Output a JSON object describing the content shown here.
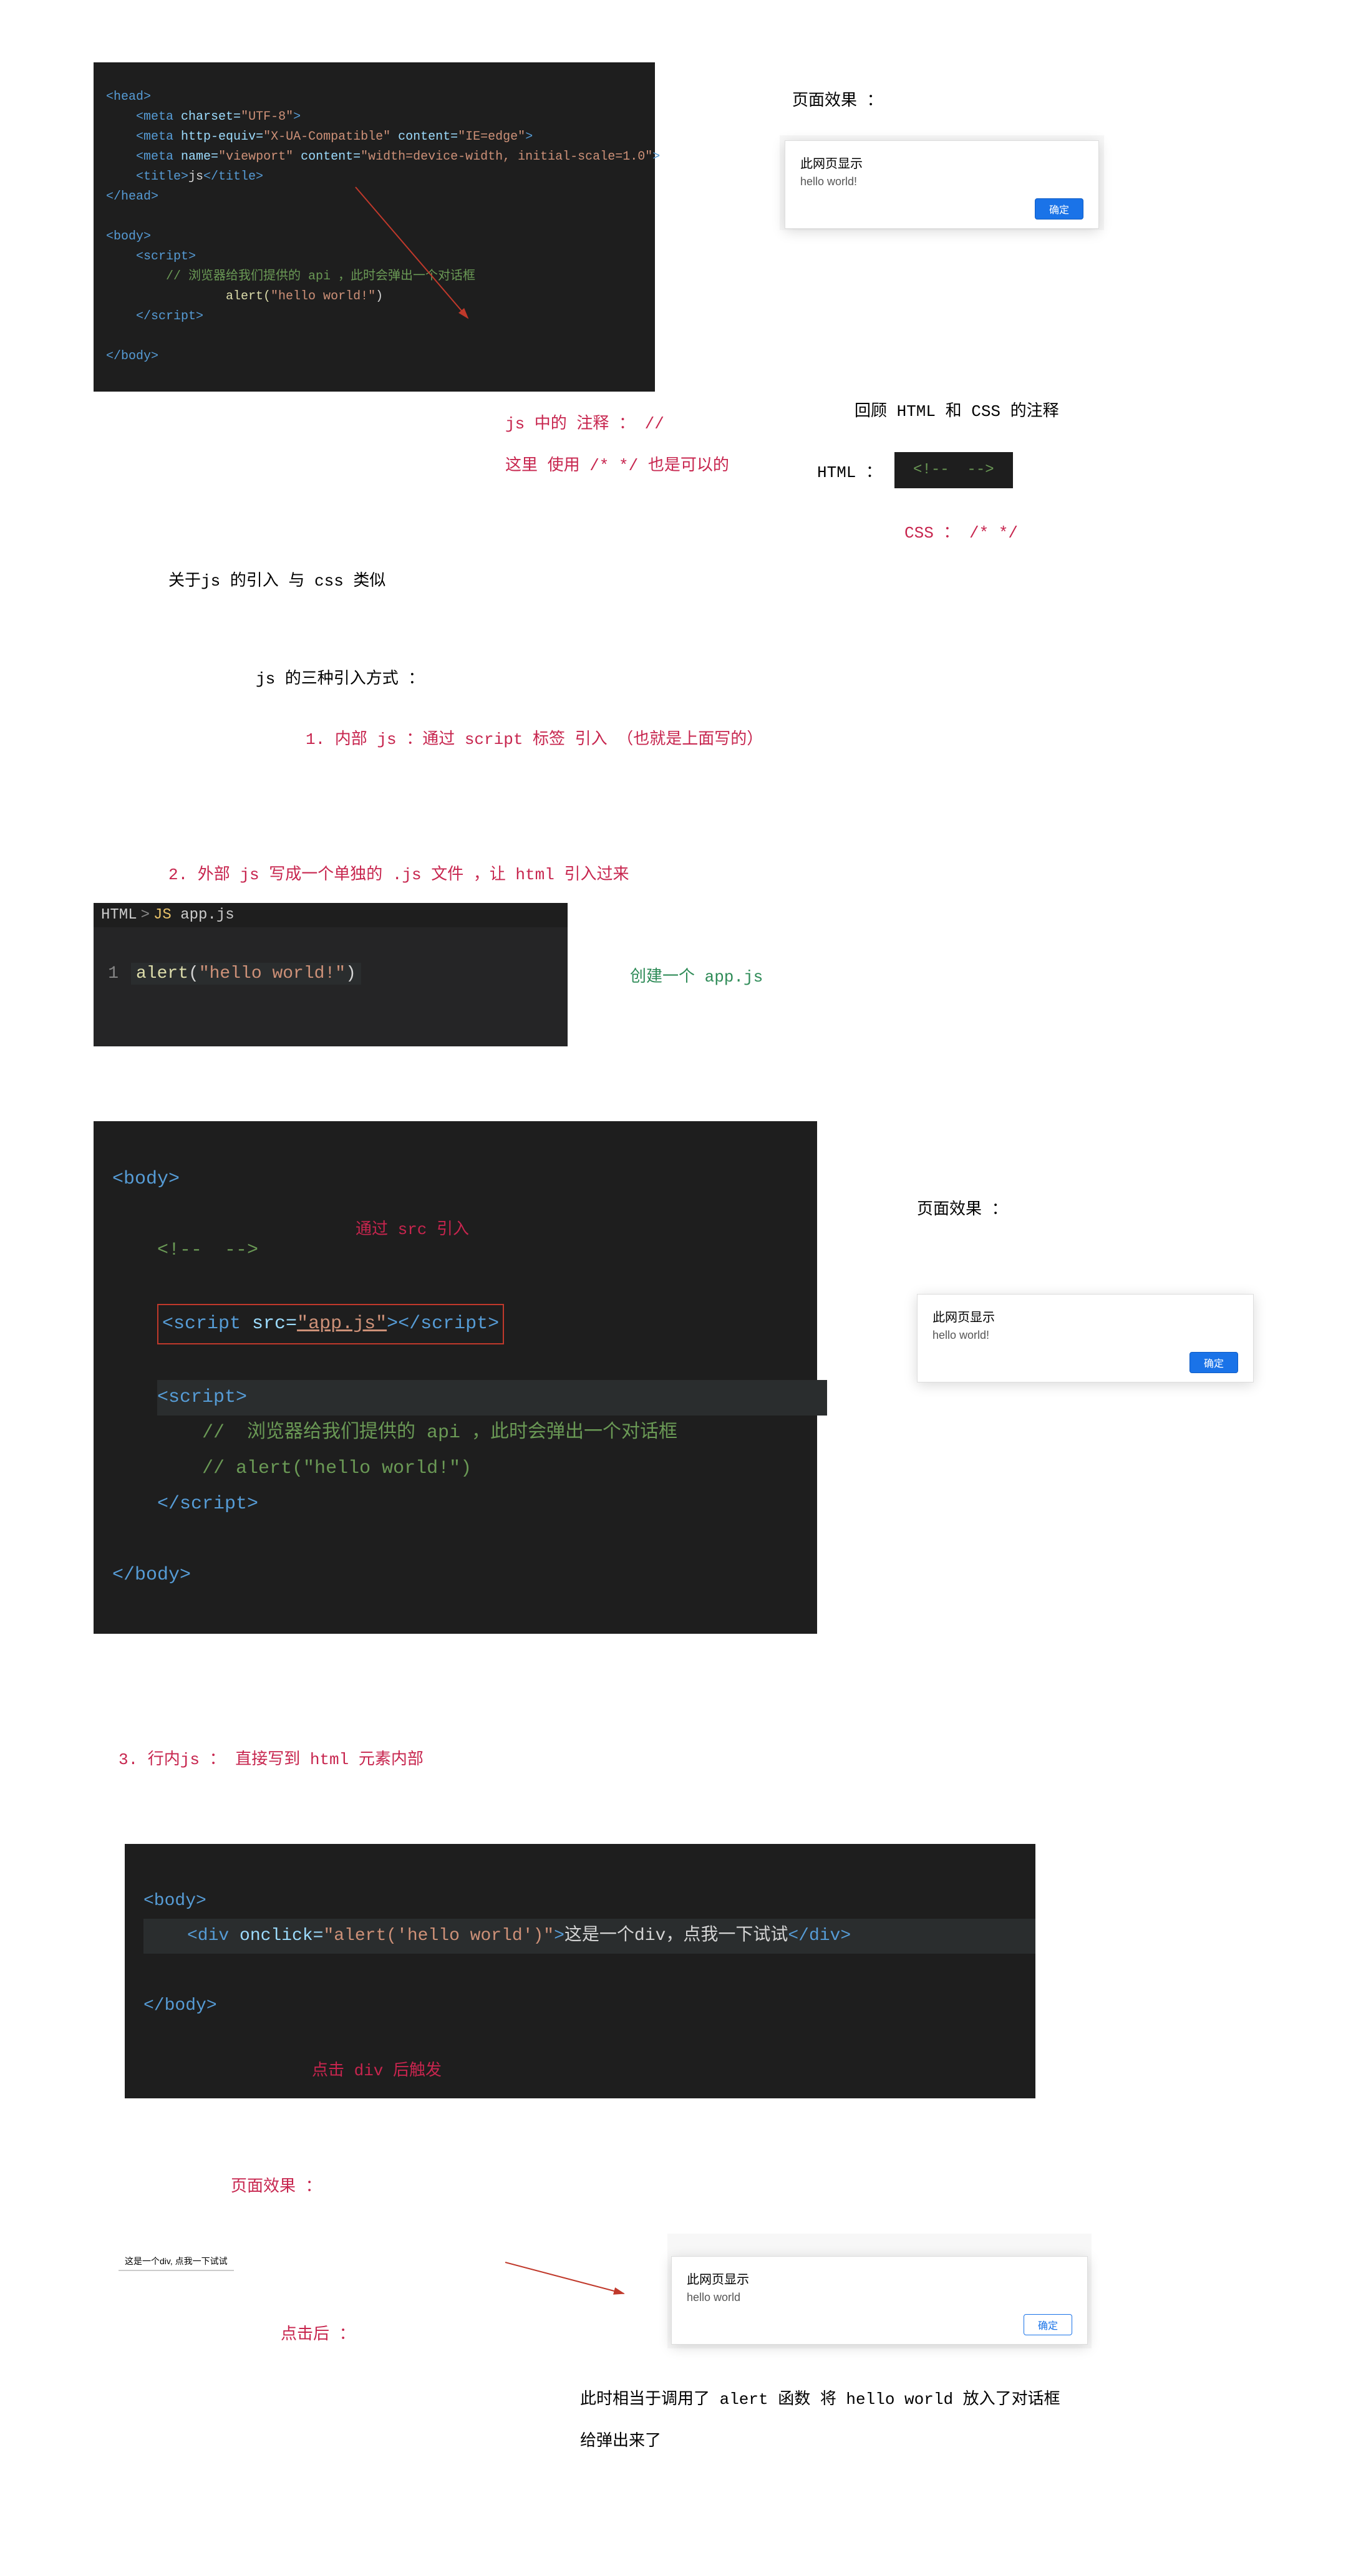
{
  "code1": {
    "l1": "<head>",
    "l2": "    <meta charset=\"UTF-8\">",
    "l3": "    <meta http-equiv=\"X-UA-Compatible\" content=\"IE=edge\">",
    "l4": "    <meta name=\"viewport\" content=\"width=device-width, initial-scale=1.0\">",
    "l5": "    <title>js</title>",
    "l6": "</head>",
    "l8": "<body>",
    "l9": "    <script>",
    "l10a": "        // 浏览器给我们提供的 api ，此时会弹出一个对话框",
    "l11a": "        alert(",
    "l11b": "\"hello world!\"",
    "l11c": ")",
    "l12": "    </script>",
    "l14": "</body>"
  },
  "labels": {
    "pageEffect": "页面效果 ：",
    "jsComment1": "js 中的 注释 ： //",
    "jsComment2": "这里 使用 /* */ 也是可以的",
    "jsImport": "关于js 的引入  与 css 类似",
    "reviewComment": "回顾 HTML 和 CSS 的注释",
    "htmlLabel": "HTML ：",
    "htmlCmt": "<!--  -->",
    "cssLabel": "CSS ： /* */",
    "threeWays": "js 的三种引入方式 ：",
    "way1": "1. 内部 js ：通过 script 标签 引入 （也就是上面写的）",
    "way2": "2. 外部 js 写成一个单独的 .js 文件 ，让 html 引入过来",
    "createApp": "创建一个 app.js",
    "viaSrc": "通过 src 引入",
    "way3": "3. 行内js ： 直接写到 html 元素内部",
    "clickDiv": "点击 div 后触发",
    "afterClick": "点击后 ：",
    "explain1": "此时相当于调用了 alert 函数 将 hello world 放入了对话框",
    "explain2": "给弹出来了",
    "divDemo": "这是一个div, 点我一下试试"
  },
  "dialog1": {
    "title": "此网页显示",
    "msg": "hello world!",
    "btn": "确定"
  },
  "dialog2": {
    "title": "此网页显示",
    "msg": "hello world!",
    "btn": "确定"
  },
  "dialog3": {
    "title": "此网页显示",
    "msg": "hello world",
    "btn": "确定"
  },
  "breadcrumb": {
    "folder": "HTML",
    "file": "app.js",
    "js": "JS"
  },
  "appjs": {
    "num": "1",
    "fn": "alert",
    "arg": "\"hello world!\""
  },
  "code2": {
    "l1": "<body>",
    "cmt": "<!--  -->",
    "scriptSrc1": "<script ",
    "scriptSrc2": "src=",
    "scriptSrc3": "\"app.js\"",
    "scriptSrc4": "></script>",
    "s1": "<script>",
    "c1": "//  浏览器给我们提供的 api ，此时会弹出一个对话框",
    "c2": "// alert(\"hello world!\")",
    "s2": "</script>",
    "l9": "</body>"
  },
  "code3": {
    "l1": "<body>",
    "divOpen": "<div ",
    "attr": "onclick=",
    "val": "\"alert('hello world')\"",
    "close": ">",
    "text": "这是一个div，点我一下试试",
    "divClose": "</div>",
    "l3": "</body>"
  }
}
